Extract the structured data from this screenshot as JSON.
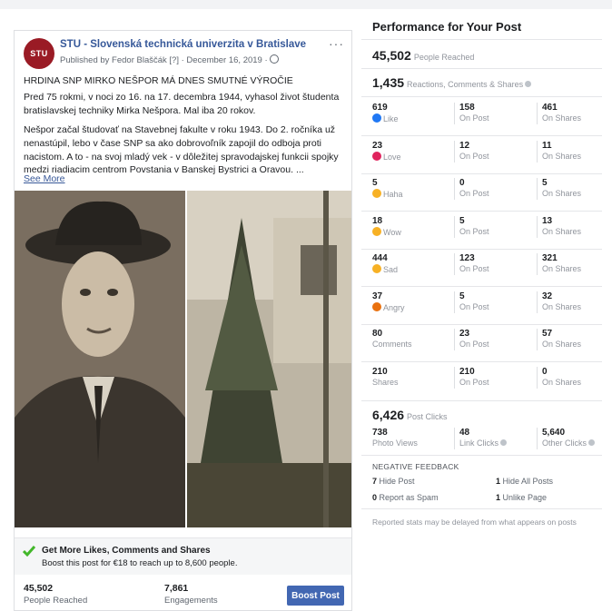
{
  "post": {
    "avatar_text": "STU",
    "page_name": "STU - Slovenská technická univerzita v Bratislave",
    "publisher": "Published by Fedor Blaščák [?] · December 16, 2019 ·",
    "more": "···",
    "headline": "HRDINA SNP MIRKO NEŠPOR MÁ DNES SMUTNÉ VÝROČIE",
    "para1": "Pred 75 rokmi, v noci zo 16. na 17. decembra 1944, vyhasol život študenta bratislavskej techniky Mirka Nešpora. Mal iba 20 rokov.",
    "para2": "Nešpor začal študovať na Stavebnej fakulte v roku 1943. Do 2. ročníka už nenastúpil, lebo v čase SNP sa ako dobrovoľník zapojil do odboja proti nacistom. A to - na svoj mladý vek - v dôležitej spravodajskej funkcii spojky medzi riadiacim centrom Povstania v Banskej Bystrici a Oravou. ...",
    "see_more": "See More",
    "promo_title": "Get More Likes, Comments and Shares",
    "promo_sub": "Boost this post for €18 to reach up to 8,600 people.",
    "stats": [
      {
        "value": "45,502",
        "label": "People Reached"
      },
      {
        "value": "7,861",
        "label": "Engagements"
      }
    ],
    "boost_label": "Boost Post",
    "colors": {
      "link": "#365899",
      "boost": "#4267b2",
      "check": "#42b72a"
    }
  },
  "performance": {
    "title": "Performance for Your Post",
    "reached": {
      "value": "45,502",
      "label": "People Reached"
    },
    "engagement": {
      "value": "1,435",
      "label": "Reactions, Comments & Shares"
    },
    "rows": [
      {
        "icon": "like-icon",
        "total": "619",
        "total_label": "Like",
        "on_post": "158",
        "on_post_label": "On Post",
        "on_shares": "461",
        "on_shares_label": "On Shares"
      },
      {
        "icon": "love-icon",
        "total": "23",
        "total_label": "Love",
        "on_post": "12",
        "on_post_label": "On Post",
        "on_shares": "11",
        "on_shares_label": "On Shares"
      },
      {
        "icon": "haha-icon",
        "total": "5",
        "total_label": "Haha",
        "on_post": "0",
        "on_post_label": "On Post",
        "on_shares": "5",
        "on_shares_label": "On Shares"
      },
      {
        "icon": "wow-icon",
        "total": "18",
        "total_label": "Wow",
        "on_post": "5",
        "on_post_label": "On Post",
        "on_shares": "13",
        "on_shares_label": "On Shares"
      },
      {
        "icon": "sad-icon",
        "total": "444",
        "total_label": "Sad",
        "on_post": "123",
        "on_post_label": "On Post",
        "on_shares": "321",
        "on_shares_label": "On Shares"
      },
      {
        "icon": "angry-icon",
        "total": "37",
        "total_label": "Angry",
        "on_post": "5",
        "on_post_label": "On Post",
        "on_shares": "32",
        "on_shares_label": "On Shares"
      },
      {
        "icon": "",
        "total": "80",
        "total_label": "Comments",
        "on_post": "23",
        "on_post_label": "On Post",
        "on_shares": "57",
        "on_shares_label": "On Shares"
      },
      {
        "icon": "",
        "total": "210",
        "total_label": "Shares",
        "on_post": "210",
        "on_post_label": "On Post",
        "on_shares": "0",
        "on_shares_label": "On Shares"
      }
    ],
    "clicks": {
      "value": "6,426",
      "label": "Post Clicks"
    },
    "click_breakdown": [
      {
        "value": "738",
        "label": "Photo Views"
      },
      {
        "value": "48",
        "label": "Link Clicks"
      },
      {
        "value": "5,640",
        "label": "Other Clicks"
      }
    ],
    "negative_feedback": {
      "title": "NEGATIVE FEEDBACK",
      "items": [
        {
          "count": "7",
          "label": "Hide Post"
        },
        {
          "count": "1",
          "label": "Hide All Posts"
        },
        {
          "count": "0",
          "label": "Report as Spam"
        },
        {
          "count": "1",
          "label": "Unlike Page"
        }
      ]
    },
    "footnote": "Reported stats may be delayed from what appears on posts",
    "reaction_colors": {
      "like": "#2078f4",
      "love": "#e0245e",
      "haha": "#f7b125",
      "wow": "#f7b125",
      "sad": "#f7b125",
      "angry": "#e9710f"
    }
  }
}
